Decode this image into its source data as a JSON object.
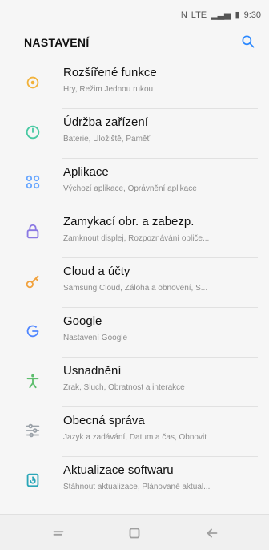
{
  "status": {
    "time": "9:30",
    "network": "LTE"
  },
  "header": {
    "title": "NASTAVENÍ"
  },
  "items": [
    {
      "label": "Rozšířené funkce",
      "sub": "Hry, Režim Jednou rukou",
      "color": "#f2b23a"
    },
    {
      "label": "Údržba zařízení",
      "sub": "Baterie, Úložiště, Paměť",
      "color": "#49c9a3"
    },
    {
      "label": "Aplikace",
      "sub": "Výchozí aplikace, Oprávnění aplikace",
      "color": "#67a6ff"
    },
    {
      "label": "Zamykací obr. a zabezp.",
      "sub": "Zamknout displej, Rozpoznávání obliče...",
      "color": "#8a78e3"
    },
    {
      "label": "Cloud a účty",
      "sub": "Samsung Cloud, Záloha a obnovení, S...",
      "color": "#f1a23e"
    },
    {
      "label": "Google",
      "sub": "Nastavení Google",
      "color": "#4f86ff"
    },
    {
      "label": "Usnadnění",
      "sub": "Zrak, Sluch, Obratnost a interakce",
      "color": "#5dbd6d"
    },
    {
      "label": "Obecná správa",
      "sub": "Jazyk a zadávání, Datum a čas, Obnovit",
      "color": "#9aa1a8"
    },
    {
      "label": "Aktualizace softwaru",
      "sub": "Stáhnout aktualizace, Plánované aktual...",
      "color": "#2aa6b8"
    }
  ]
}
